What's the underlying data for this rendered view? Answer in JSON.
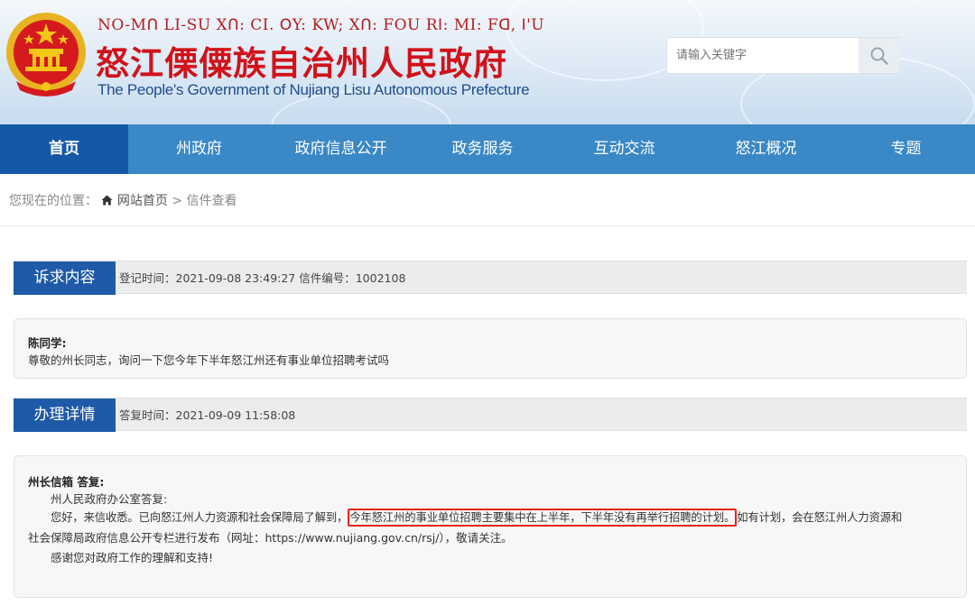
{
  "header": {
    "lisu_title": "NO-Mꓵ LI-SU Xꓵ: CI. ꓳY: KW; Xꓵ: FOU Rꓲ: MI: Fꓷ, ꓲ'U",
    "cn_title": "怒江傈僳族自治州人民政府",
    "en_title": "The People's Government of Nujiang Lisu Autonomous Prefecture",
    "search_placeholder": "请输入关键字",
    "colors": {
      "brand_red": "#d0121a",
      "brand_blue": "#1d4d8c"
    }
  },
  "nav": {
    "items": [
      "首页",
      "州政府",
      "政府信息公开",
      "政务服务",
      "互动交流",
      "怒江概况",
      "专题"
    ],
    "active_index": 0,
    "colors": {
      "bar": "#3a88c6",
      "active": "#1558a6"
    }
  },
  "breadcrumb": {
    "prefix": "您现在的位置：",
    "home": "网站首页",
    "separator": ">",
    "current": "信件查看"
  },
  "request": {
    "tag": "诉求内容",
    "meta": "登记时间：2021-09-08 23:49:27 信件编号：1002108",
    "author": "陈同学:",
    "body": "尊敬的州长同志，询问一下您今年下半年怒江州还有事业单位招聘考试吗"
  },
  "reply": {
    "tag": "办理详情",
    "meta": "答复时间：2021-09-09 11:58:08",
    "author": "州长信箱 答复:",
    "line1": "州人民政府办公室答复:",
    "line2_pre": "您好，来信收悉。已向怒江州人力资源和社会保障局了解到，",
    "line2_hl": "今年怒江州的事业单位招聘主要集中在上半年，下半年没有再举行招聘的计划。",
    "line2_post": "如有计划，会在怒江州人力资源和",
    "line3": "社会保障局政府信息公开专栏进行发布（网址：https://www.nujiang.gov.cn/rsj/），敬请关注。",
    "line4": "感谢您对政府工作的理解和支持!"
  },
  "colors": {
    "section_tag": "#1f5aa8",
    "highlight_border": "#e8231b"
  }
}
